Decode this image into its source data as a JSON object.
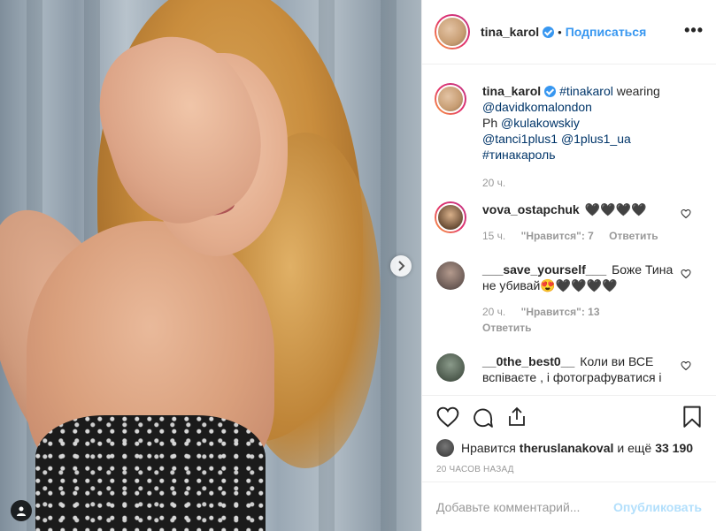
{
  "header": {
    "username": "tina_karol",
    "separator": "•",
    "follow_label": "Подписаться",
    "more_label": "•••"
  },
  "caption": {
    "username": "tina_karol",
    "text_parts": [
      "#tinakarol",
      " wearing ",
      "@davidkomalondon",
      "Ph ",
      "@kulakowskiy",
      "@tanci1plus1",
      " ",
      "@1plus1_ua",
      "#тинакароль"
    ],
    "time": "20 ч."
  },
  "comments": [
    {
      "username": "vova_ostapchuk",
      "text": "🖤🖤🖤🖤",
      "time": "15 ч.",
      "likes": "\"Нравится\": 7",
      "reply": "Ответить"
    },
    {
      "username": "___save_yourself___",
      "text": "Боже Тина не убивай😍🖤🖤🖤🖤",
      "time": "20 ч.",
      "likes": "\"Нравится\": 13",
      "reply": "Ответить"
    },
    {
      "username": "__0the_best0__",
      "text": "Коли ви ВСЕ вспіваєте , і фотографуватися і",
      "time": "",
      "likes": "",
      "reply": ""
    }
  ],
  "likes": {
    "prefix": "Нравится",
    "user": "theruslanakoval",
    "suffix": "и ещё",
    "count": "33 190"
  },
  "posted_ago": "20 часов назад",
  "add_comment": {
    "placeholder": "Добавьте комментарий...",
    "publish_label": "Опубликовать"
  },
  "colors": {
    "link": "#003569",
    "accent": "#3897f0",
    "publish_disabled": "#b2dffc"
  },
  "icons": [
    "heart-icon",
    "comment-icon",
    "share-icon",
    "bookmark-icon",
    "chevron-right-icon",
    "user-tag-icon",
    "verified-icon"
  ]
}
